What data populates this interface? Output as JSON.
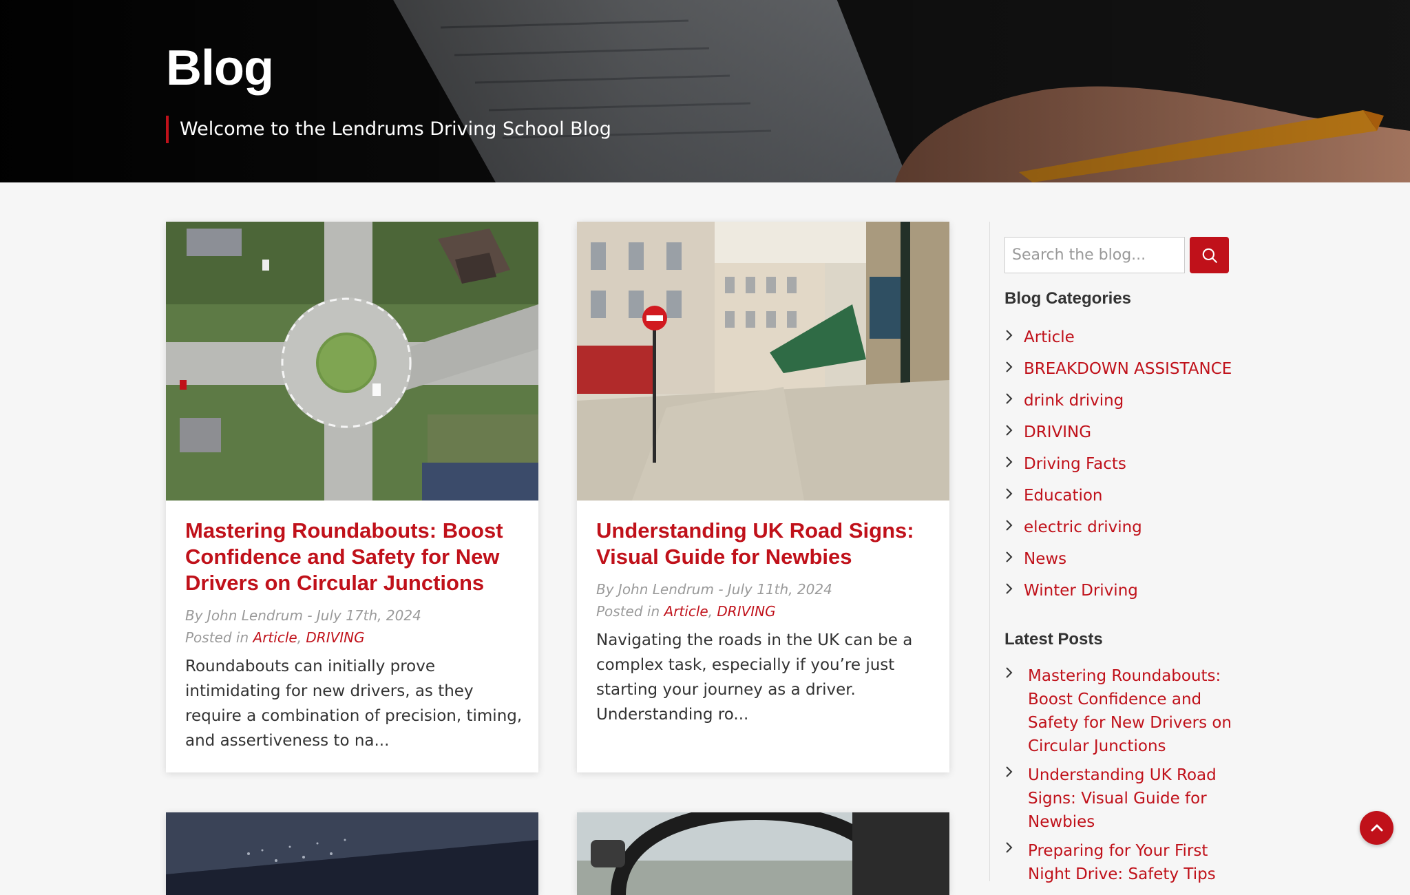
{
  "hero": {
    "title": "Blog",
    "tagline": "Welcome to the Lendrums Driving School Blog"
  },
  "posts": [
    {
      "title": "Mastering Roundabouts: Boost Confidence and Safety for New Drivers on Circular Junctions",
      "byline": "By John Lendrum - July 17th, 2024",
      "posted_in_label": "Posted in",
      "categories": [
        "Article",
        "DRIVING"
      ],
      "excerpt": "Roundabouts can initially prove intimidating for new drivers, as they require a combination of precision, timing, and assertiveness to na..."
    },
    {
      "title": "Understanding UK Road Signs: Visual Guide for Newbies",
      "byline": "By John Lendrum - July 11th, 2024",
      "posted_in_label": "Posted in",
      "categories": [
        "Article",
        "DRIVING"
      ],
      "excerpt": "Navigating the roads in the UK can be a complex task, especially if you’re just starting your journey as a driver. Understanding ro..."
    }
  ],
  "sidebar": {
    "search_placeholder": "Search the blog...",
    "categories_heading": "Blog Categories",
    "categories": [
      "Article",
      "BREAKDOWN ASSISTANCE",
      "drink driving",
      "DRIVING",
      "Driving Facts",
      "Education",
      "electric driving",
      "News",
      "Winter Driving"
    ],
    "latest_heading": "Latest Posts",
    "latest": [
      "Mastering Roundabouts: Boost Confidence and Safety for New Drivers on Circular Junctions",
      "Understanding UK Road Signs: Visual Guide for Newbies",
      "Preparing for Your First Night Drive: Safety Tips"
    ]
  },
  "icons": {
    "search": "search-icon",
    "chevron": "chevron-right-icon",
    "back_to_top": "chevron-up-icon"
  },
  "colors": {
    "accent": "#c0111a",
    "text": "#333333",
    "meta": "#9a9a9a",
    "background": "#f6f6f6"
  }
}
